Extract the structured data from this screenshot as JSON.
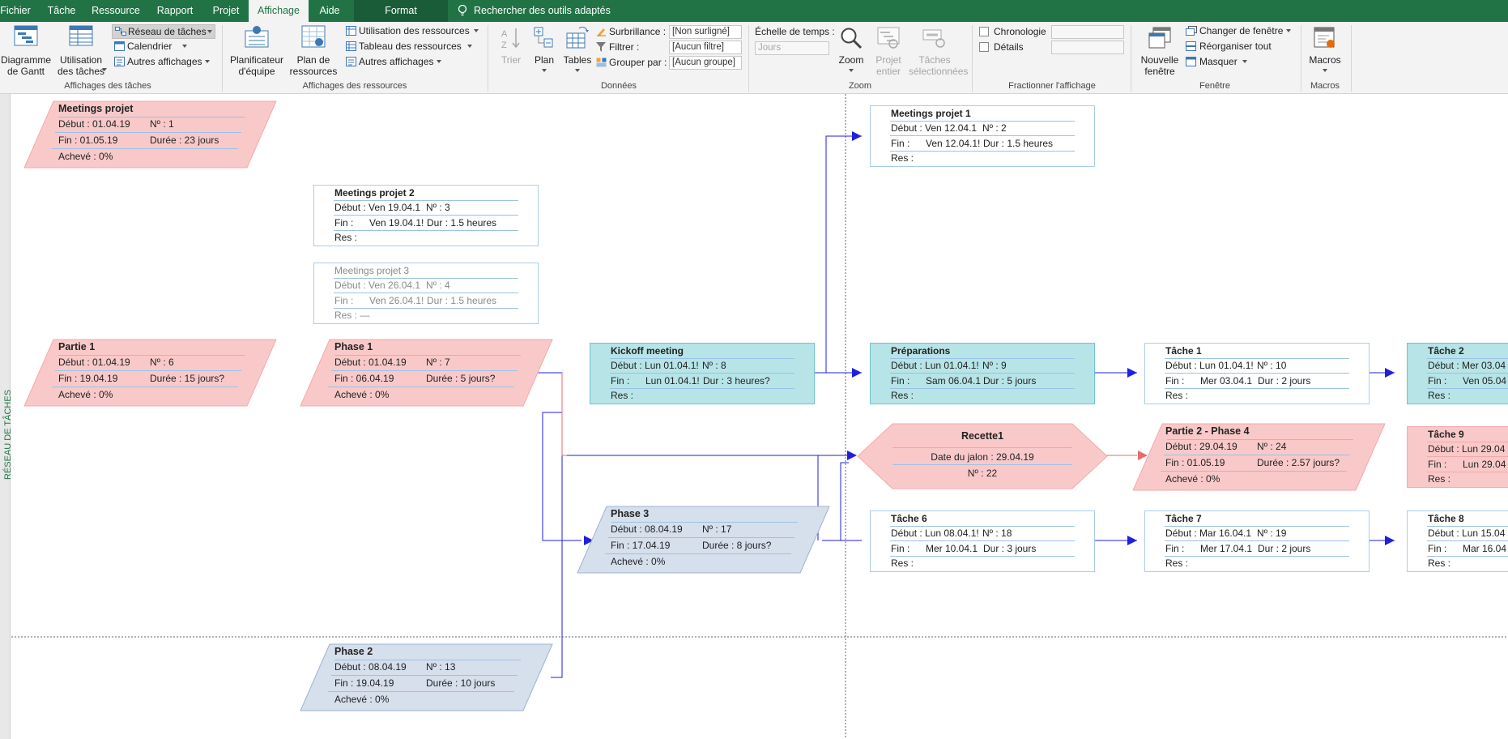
{
  "menu": {
    "tabs": [
      "Fichier",
      "Tâche",
      "Ressource",
      "Rapport",
      "Projet",
      "Affichage",
      "Aide",
      "Format"
    ],
    "search": "Rechercher des outils adaptés"
  },
  "ribbon": {
    "taskviews": {
      "gantt": "Diagramme\nde Gantt",
      "usage": "Utilisation\ndes tâches",
      "network": "Réseau de tâches",
      "calendar": "Calendrier",
      "other": "Autres affichages",
      "label": "Affichages des tâches"
    },
    "resviews": {
      "planner": "Planificateur\nd'équipe",
      "plan": "Plan de\nressources",
      "usage": "Utilisation des ressources",
      "sheet": "Tableau des ressources",
      "other": "Autres affichages",
      "label": "Affichages des ressources"
    },
    "data": {
      "sort": "Trier",
      "outline": "Plan",
      "tables": "Tables",
      "highlight": "Surbrillance :",
      "highlight_value": "[Non surligné]",
      "filter": "Filtrer :",
      "filter_value": "[Aucun filtre]",
      "group": "Grouper par :",
      "group_value": "[Aucun groupe]",
      "label": "Données"
    },
    "zoom": {
      "timescale": "Échelle de temps :",
      "timescale_value": "Jours",
      "zoom": "Zoom",
      "project": "Projet\nentier",
      "selected": "Tâches\nsélectionnées",
      "label": "Zoom"
    },
    "split": {
      "timeline": "Chronologie",
      "details": "Détails",
      "label": "Fractionner l'affichage"
    },
    "window": {
      "new": "Nouvelle\nfenêtre",
      "switch": "Changer de fenêtre",
      "arrange": "Réorganiser tout",
      "hide": "Masquer",
      "label": "Fenêtre"
    },
    "macros": {
      "macros": "Macros",
      "label": "Macros"
    }
  },
  "sidebar": {
    "label": "RÉSEAU DE TÂCHES"
  },
  "colors": {
    "summary_pink": "#f9c9c9",
    "critical_cyan": "#b7e4e7",
    "phase_blue": "#d6dfec",
    "link_blue": "#1f1fe0",
    "link_red": "#e86a6a",
    "ribbon_green": "#217346"
  },
  "nodes": {
    "meetings": {
      "title": "Meetings projet",
      "debut": "Début :  01.04.19",
      "no": "Nº :    1",
      "fin": "Fin : 01.05.19",
      "duree": "Durée : 23 jours",
      "acheve": "Achevé : 0%"
    },
    "mp2": {
      "title": "Meetings projet 2",
      "debut": "Début :  Ven 19.04.1",
      "no": "Nº :  3",
      "fin": "Fin :",
      "fin_v": "Ven 19.04.1!",
      "dur": "Dur : 1.5 heures",
      "res": "Res :"
    },
    "mp3": {
      "title": "Meetings projet 3",
      "debut": "Début :  Ven 26.04.1",
      "no": "Nº :  4",
      "fin": "Fin :",
      "fin_v": "Ven 26.04.1!",
      "dur": "Dur : 1.5 heures",
      "res": "Res : —"
    },
    "mp1": {
      "title": "Meetings projet 1",
      "debut": "Début :  Ven 12.04.1",
      "no": "Nº :  2",
      "fin": "Fin :",
      "fin_v": "Ven 12.04.1!",
      "dur": "Dur : 1.5 heures",
      "res": "Res :"
    },
    "partie1": {
      "title": "Partie 1",
      "debut": "Début :  01.04.19",
      "no": "Nº :    6",
      "fin": "Fin : 19.04.19",
      "duree": "Durée : 15 jours?",
      "acheve": "Achevé : 0%"
    },
    "phase1": {
      "title": "Phase 1",
      "debut": "Début :  01.04.19",
      "no": "Nº :    7",
      "fin": "Fin : 06.04.19",
      "duree": "Durée : 5 jours?",
      "acheve": "Achevé : 0%"
    },
    "kickoff": {
      "title": "Kickoff meeting",
      "debut": "Début :  Lun 01.04.1!",
      "no": "Nº :  8",
      "fin": "Fin :",
      "fin_v": "Lun 01.04.1!",
      "dur": "Dur : 3 heures?",
      "res": "Res :"
    },
    "prep": {
      "title": "Préparations",
      "debut": "Début :  Lun 01.04.1!",
      "no": "Nº :  9",
      "fin": "Fin :",
      "fin_v": "Sam 06.04.1",
      "dur": "Dur : 5 jours",
      "res": "Res :"
    },
    "tache1": {
      "title": "Tâche 1",
      "debut": "Début :  Lun 01.04.1!",
      "no": "Nº :  10",
      "fin": "Fin :",
      "fin_v": "Mer 03.04.1",
      "dur": "Dur : 2 jours",
      "res": "Res :"
    },
    "tache2": {
      "title": "Tâche 2",
      "debut": "Début :  Mer 03.04",
      "fin": "Fin :",
      "fin_v": "Ven 05.04",
      "res": "Res :"
    },
    "recette": {
      "title": "Recette1",
      "date": "Date du jalon : 29.04.19",
      "no": "Nº : 22"
    },
    "p2p4": {
      "title": "Partie 2 - Phase 4",
      "debut": "Début :  29.04.19",
      "no": "Nº :    24",
      "fin": "Fin : 01.05.19",
      "duree": "Durée : 2.57 jours?",
      "acheve": "Achevé : 0%"
    },
    "tache9": {
      "title": "Tâche 9",
      "debut": "Début :  Lun 29.04",
      "fin": "Fin :",
      "fin_v": "Lun 29.04",
      "res": "Res :"
    },
    "phase3": {
      "title": "Phase 3",
      "debut": "Début :  08.04.19",
      "no": "Nº :    17",
      "fin": "Fin : 17.04.19",
      "duree": "Durée : 8 jours?",
      "acheve": "Achevé : 0%"
    },
    "tache6": {
      "title": "Tâche 6",
      "debut": "Début :  Lun 08.04.1!",
      "no": "Nº :  18",
      "fin": "Fin :",
      "fin_v": "Mer 10.04.1",
      "dur": "Dur : 3 jours",
      "res": "Res :"
    },
    "tache7": {
      "title": "Tâche 7",
      "debut": "Début :  Mar 16.04.1",
      "no": "Nº :  19",
      "fin": "Fin :",
      "fin_v": "Mer 17.04.1",
      "dur": "Dur : 2 jours",
      "res": "Res :"
    },
    "tache8": {
      "title": "Tâche 8",
      "debut": "Début :  Lun 15.04",
      "fin": "Fin :",
      "fin_v": "Mar 16.04",
      "res": "Res :"
    },
    "phase2": {
      "title": "Phase 2",
      "debut": "Début :  08.04.19",
      "no": "Nº :    13",
      "fin": "Fin : 19.04.19",
      "duree": "Durée : 10 jours",
      "acheve": "Achevé : 0%"
    }
  }
}
